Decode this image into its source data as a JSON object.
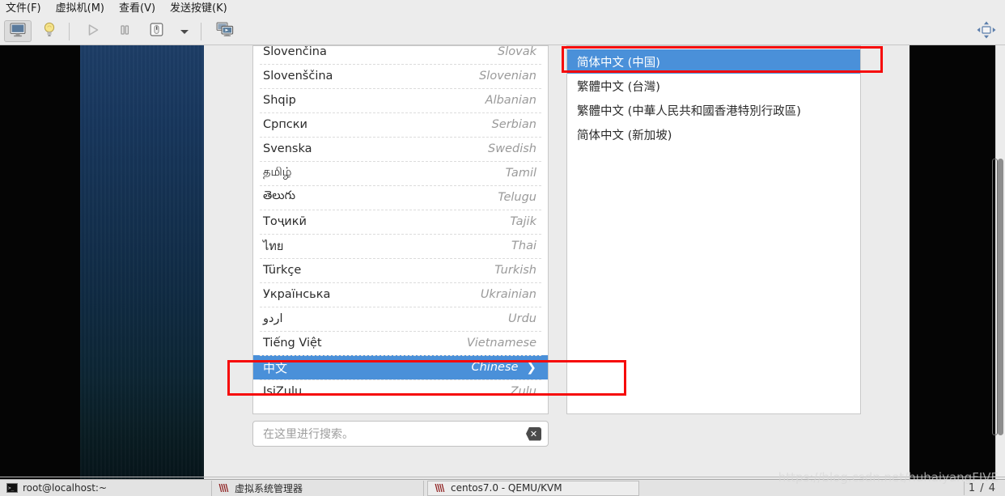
{
  "window": {
    "menubar": [
      {
        "label": "文件(F)",
        "name": "menu-file"
      },
      {
        "label": "虚拟机(M)",
        "name": "menu-virtual-machine"
      },
      {
        "label": "查看(V)",
        "name": "menu-view"
      },
      {
        "label": "发送按键(K)",
        "name": "menu-send-key"
      }
    ],
    "toolbar": {
      "console_icon": "monitor-icon",
      "details_icon": "lightbulb-icon",
      "run_icon": "play-icon",
      "pause_icon": "pause-icon",
      "shutdown_icon": "shutdown-icon",
      "shutdown_menu_icon": "chevron-down-icon",
      "snapshots_icon": "screens-icon",
      "fullscreen_icon": "resize-icon"
    }
  },
  "language_list": {
    "items": [
      {
        "native": "Slovenčina",
        "english": "Slovak",
        "selected": false
      },
      {
        "native": "Slovenščina",
        "english": "Slovenian",
        "selected": false
      },
      {
        "native": "Shqip",
        "english": "Albanian",
        "selected": false
      },
      {
        "native": "Српски",
        "english": "Serbian",
        "selected": false
      },
      {
        "native": "Svenska",
        "english": "Swedish",
        "selected": false
      },
      {
        "native": "தமிழ்",
        "english": "Tamil",
        "selected": false
      },
      {
        "native": "తెలుగు",
        "english": "Telugu",
        "selected": false
      },
      {
        "native": "Тоҷикӣ",
        "english": "Tajik",
        "selected": false
      },
      {
        "native": "ไทย",
        "english": "Thai",
        "selected": false
      },
      {
        "native": "Türkçe",
        "english": "Turkish",
        "selected": false
      },
      {
        "native": "Українська",
        "english": "Ukrainian",
        "selected": false
      },
      {
        "native": "اردو",
        "english": "Urdu",
        "selected": false
      },
      {
        "native": "Tiếng Việt",
        "english": "Vietnamese",
        "selected": false
      },
      {
        "native": "中文",
        "english": "Chinese",
        "selected": true,
        "chevron": "›"
      },
      {
        "native": "IsiZulu",
        "english": "Zulu",
        "selected": false
      }
    ]
  },
  "variant_list": {
    "items": [
      {
        "label": "简体中文 (中国)",
        "selected": true
      },
      {
        "label": "繁體中文 (台灣)",
        "selected": false
      },
      {
        "label": "繁體中文 (中華人民共和國香港特別行政區)",
        "selected": false
      },
      {
        "label": "简体中文 (新加坡)",
        "selected": false
      }
    ]
  },
  "search": {
    "placeholder": "在这里进行搜索。",
    "value": "",
    "clear_icon": "clear-x-icon"
  },
  "annotations": {
    "chinese_highlight_color": "#f60a0a",
    "selection_color": "#4a90d9"
  },
  "taskbar": {
    "items": [
      {
        "label": "root@localhost:~",
        "icon": "terminal-icon"
      },
      {
        "label": "虚拟系统管理器",
        "icon": "vm-icon"
      },
      {
        "label": "centos7.0 - QEMU/KVM",
        "icon": "vm-icon"
      }
    ],
    "pager": "1 / 4",
    "watermark": "https://blog.csdn.net/huhaiyangFIVE"
  }
}
